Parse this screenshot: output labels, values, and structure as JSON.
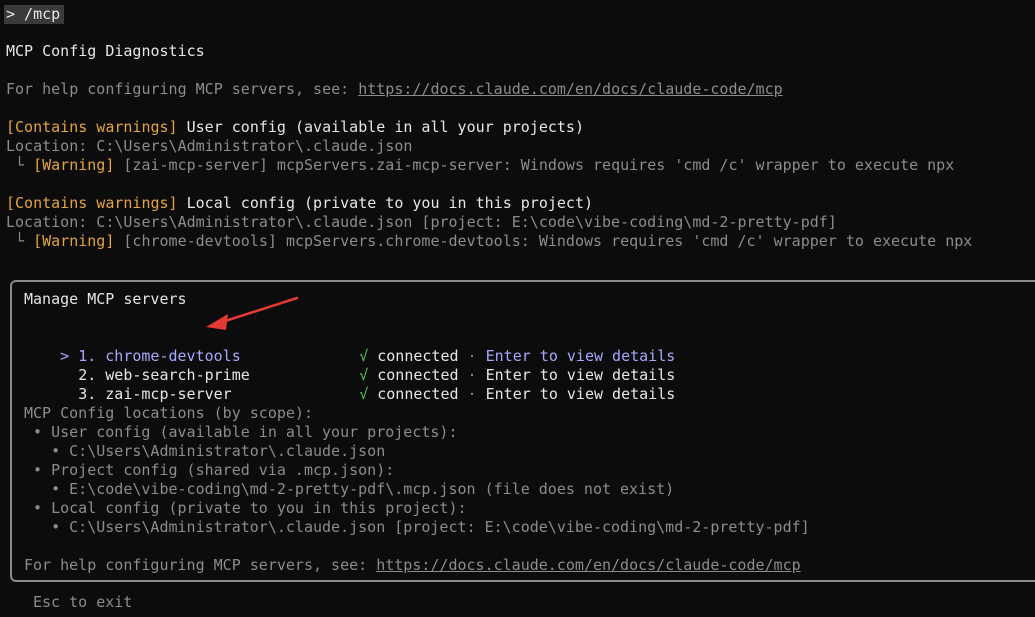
{
  "command": "> /mcp",
  "title": "MCP Config Diagnostics",
  "help": {
    "prefix": "For help configuring MCP servers, see: ",
    "url": "https://docs.claude.com/en/docs/claude-code/mcp"
  },
  "configs": [
    {
      "tag": "[Contains warnings]",
      "heading": " User config (available in all your projects)",
      "location": "Location: C:\\Users\\Administrator\\.claude.json",
      "warning_prefix": " └ ",
      "warning_tag": "[Warning]",
      "warning_text": " [zai-mcp-server] mcpServers.zai-mcp-server: Windows requires 'cmd /c' wrapper to execute npx"
    },
    {
      "tag": "[Contains warnings]",
      "heading": " Local config (private to you in this project)",
      "location": "Location: C:\\Users\\Administrator\\.claude.json [project: E:\\code\\vibe-coding\\md-2-pretty-pdf]",
      "warning_prefix": " └ ",
      "warning_tag": "[Warning]",
      "warning_text": " [chrome-devtools] mcpServers.chrome-devtools: Windows requires 'cmd /c' wrapper to execute npx"
    }
  ],
  "panel": {
    "title": "Manage MCP servers",
    "servers": [
      {
        "cursor": ">",
        "name": "1. chrome-devtools",
        "check": "√",
        "status": "connected",
        "sep": " · ",
        "action": "Enter to view details"
      },
      {
        "cursor": " ",
        "name": "2. web-search-prime",
        "check": "√",
        "status": "connected",
        "sep": " · ",
        "action": "Enter to view details"
      },
      {
        "cursor": " ",
        "name": "3. zai-mcp-server",
        "check": "√",
        "status": "connected",
        "sep": " · ",
        "action": "Enter to view details"
      }
    ],
    "locations_title": "MCP Config locations (by scope):",
    "locations": [
      {
        "label": " • User config (available in all your projects):",
        "path": "   • C:\\Users\\Administrator\\.claude.json"
      },
      {
        "label": " • Project config (shared via .mcp.json):",
        "path": "   • E:\\code\\vibe-coding\\md-2-pretty-pdf\\.mcp.json (file does not exist)"
      },
      {
        "label": " • Local config (private to you in this project):",
        "path": "   • C:\\Users\\Administrator\\.claude.json [project: E:\\code\\vibe-coding\\md-2-pretty-pdf]"
      }
    ],
    "help_prefix": "For help configuring MCP servers, see: ",
    "help_url": "https://docs.claude.com/en/docs/claude-code/mcp"
  },
  "footer": "Esc to exit",
  "colors": {
    "background": "#0c0c0c",
    "warning": "#e5a53a",
    "connected": "#4ec94e",
    "selected": "#a7a7ff",
    "annotation_arrow": "#e53935"
  }
}
